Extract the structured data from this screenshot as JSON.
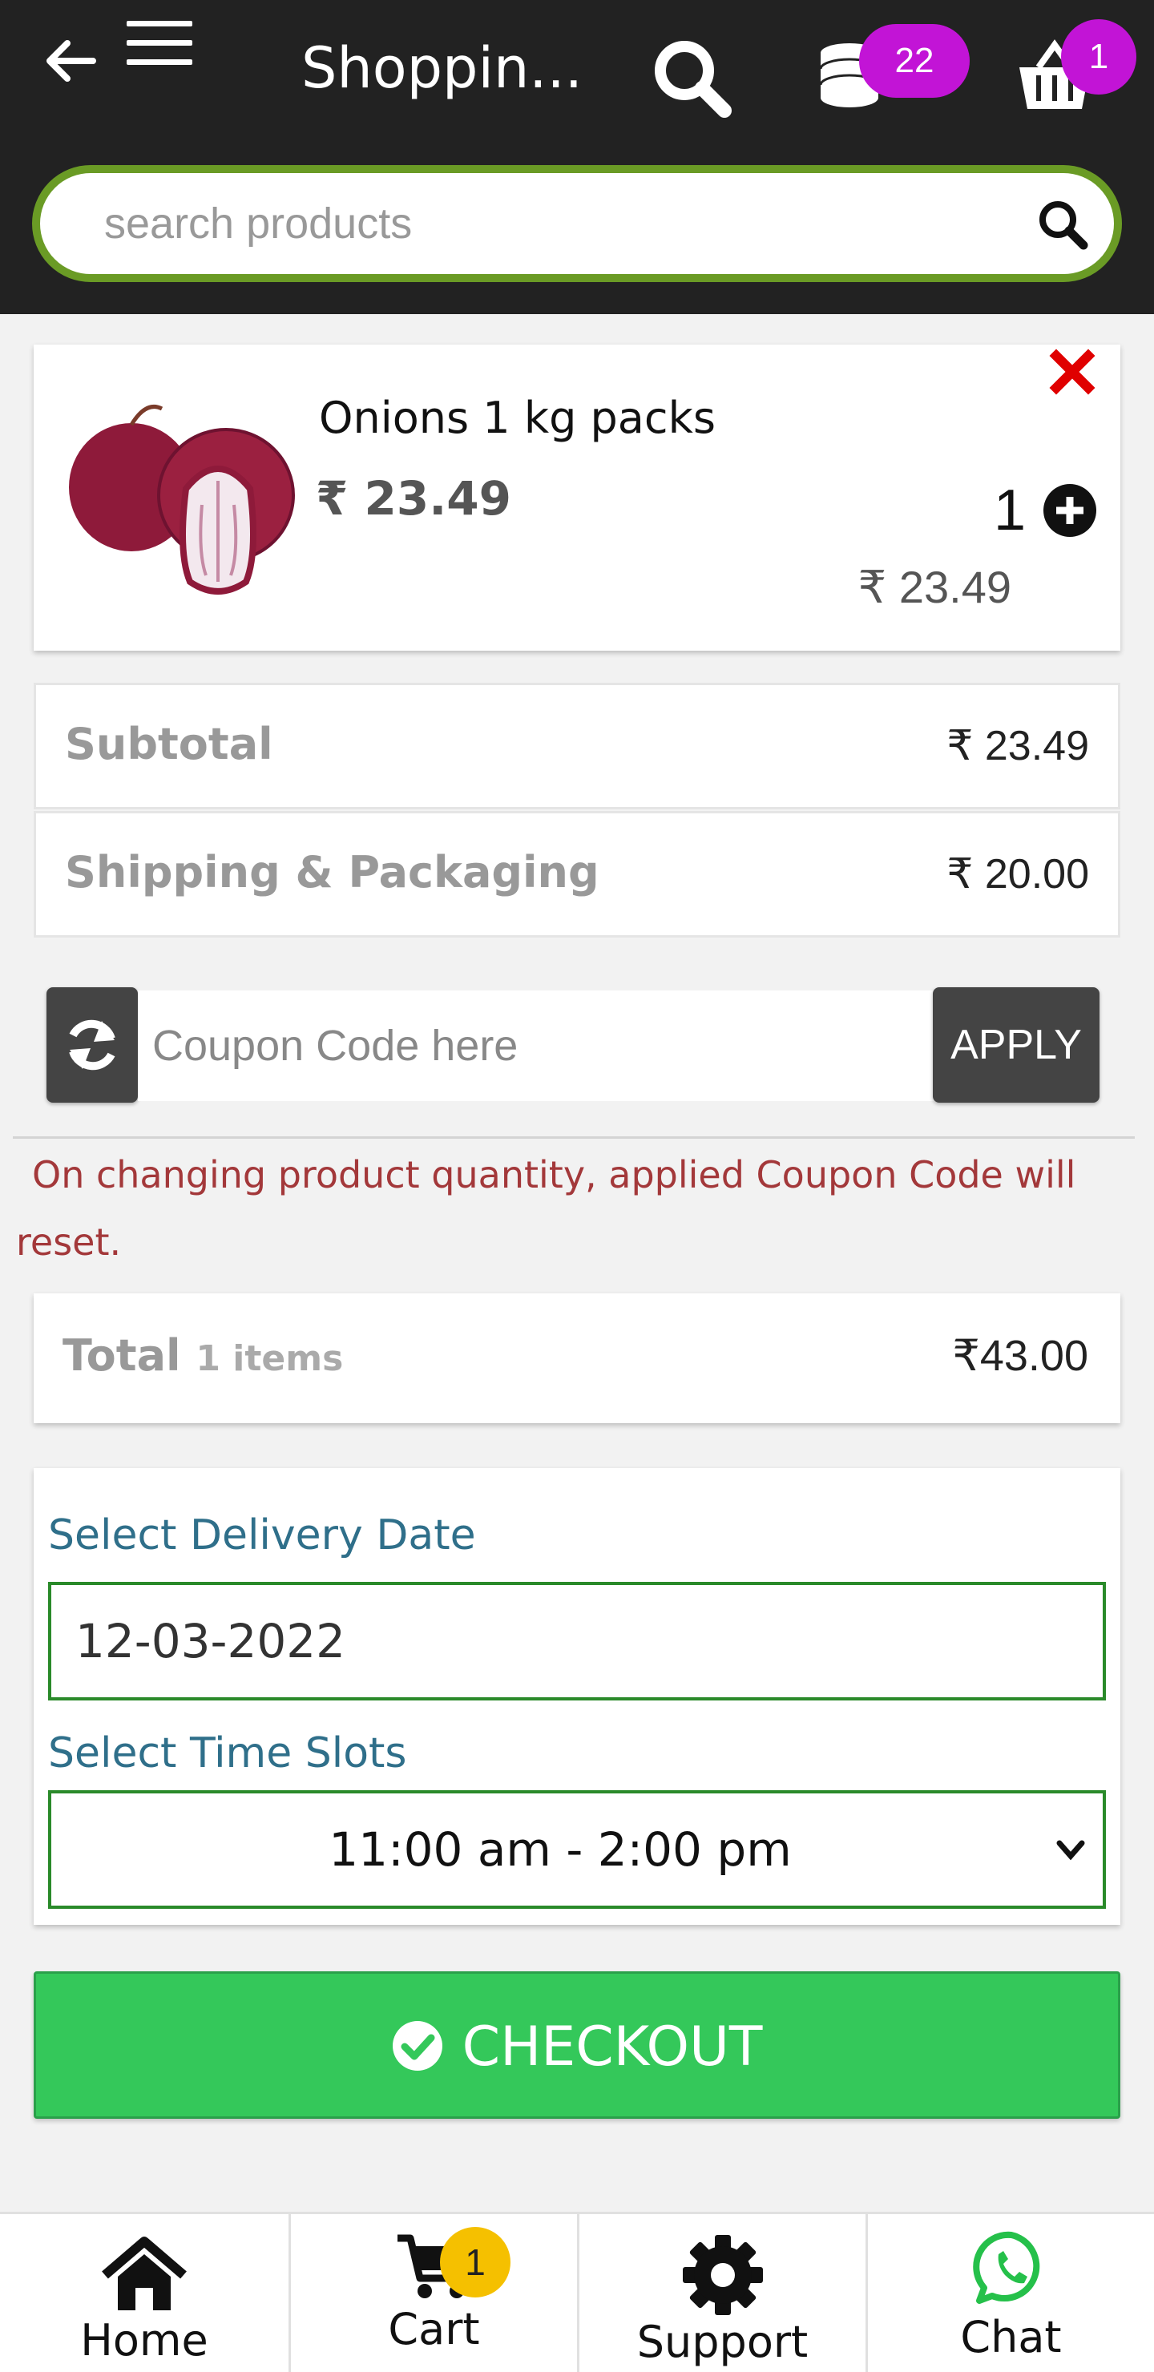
{
  "header": {
    "title": "Shoppin...",
    "coins_badge": "22",
    "cart_badge": "1",
    "search_placeholder": "search products"
  },
  "cart_item": {
    "name": "Onions 1 kg packs",
    "price": "₹ 23.49",
    "quantity": "1",
    "line_total": "₹ 23.49"
  },
  "summary": {
    "subtotal_label": "Subtotal",
    "subtotal_value": "₹ 23.49",
    "shipping_label": "Shipping & Packaging",
    "shipping_value": "₹ 20.00"
  },
  "coupon": {
    "placeholder": "Coupon Code here",
    "apply_label": "APPLY",
    "note": "On changing product quantity, applied Coupon Code will reset."
  },
  "total": {
    "label": "Total",
    "items": "1 items",
    "value": "₹43.00"
  },
  "delivery": {
    "date_label": "Select Delivery Date",
    "date_value": "12-03-2022",
    "slot_label": "Select Time Slots",
    "slot_value": "11:00 am - 2:00 pm"
  },
  "checkout": {
    "label": "CHECKOUT"
  },
  "bottom_nav": {
    "home": "Home",
    "cart": "Cart",
    "cart_badge": "1",
    "support": "Support",
    "chat": "Chat"
  },
  "colors": {
    "header_bg": "#222222",
    "search_border": "#6a9b25",
    "badge": "#c214d6",
    "remove": "#e00000",
    "note_text": "#a3383a",
    "delivery_label": "#2f6f8a",
    "input_border": "#2a8a2a",
    "checkout": "#34c85a",
    "chat_icon": "#25c04a",
    "cart_badge": "#f5c000"
  },
  "icons": [
    "back-arrow-icon",
    "hamburger-menu-icon",
    "search-icon",
    "coins-icon",
    "basket-icon",
    "close-icon",
    "plus-circle-icon",
    "refresh-icon",
    "check-circle-icon",
    "home-icon",
    "cart-icon",
    "gear-icon",
    "whatsapp-icon"
  ]
}
